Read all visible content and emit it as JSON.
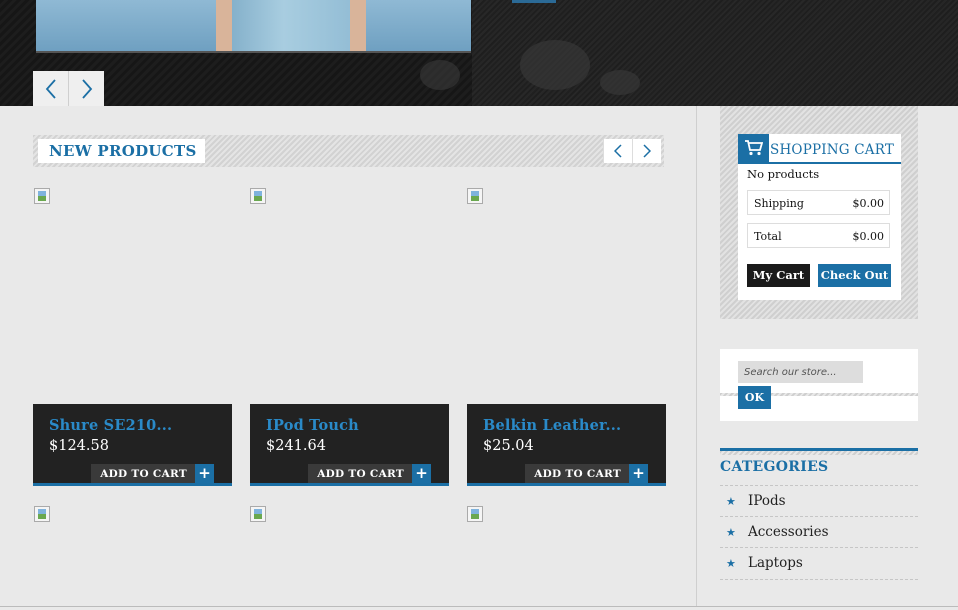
{
  "new_products": {
    "title": "NEW PRODUCTS",
    "items": [
      {
        "name": "Shure SE210...",
        "price": "$124.58",
        "add_to_cart": "ADD TO CART",
        "plus": "+"
      },
      {
        "name": "IPod Touch",
        "price": "$241.64",
        "add_to_cart": "ADD TO CART",
        "plus": "+"
      },
      {
        "name": "Belkin Leather...",
        "price": "$25.04",
        "add_to_cart": "ADD TO CART",
        "plus": "+"
      }
    ]
  },
  "cart": {
    "title": "SHOPPING CART",
    "no_products": "No products",
    "shipping_label": "Shipping",
    "shipping_value": "$0.00",
    "total_label": "Total",
    "total_value": "$0.00",
    "my_cart": "My Cart",
    "check_out": "Check Out"
  },
  "search": {
    "placeholder": "Search our store...",
    "button": "OK"
  },
  "categories": {
    "title": "CATEGORIES",
    "items": [
      "IPods",
      "Accessories",
      "Laptops"
    ]
  },
  "colors": {
    "accent": "#1b6fa5",
    "dark": "#222222",
    "background": "#e9e9e9"
  },
  "icons": {
    "cart": "cart-icon",
    "slider_prev": "chevron-left-icon",
    "slider_next": "chevron-right-icon",
    "bullet": "star-icon"
  }
}
